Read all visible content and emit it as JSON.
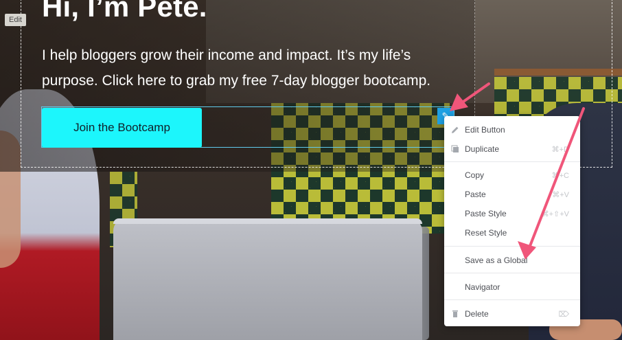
{
  "edit_tag": "Edit",
  "hero": {
    "title": "Hi, I’m Pete.",
    "text": "I help bloggers grow their income and impact. It’s my life’s purpose. Click here to grab my free 7-day blogger bootcamp.",
    "button_label": "Join the Bootcamp"
  },
  "colors": {
    "button": "#1cf6fc",
    "selection": "#61ccee",
    "handle": "#1ea0e3",
    "annotation_arrow": "#f0567a"
  },
  "context_menu": {
    "groups": [
      [
        {
          "label": "Edit Button",
          "icon": "pencil-icon",
          "shortcut": ""
        },
        {
          "label": "Duplicate",
          "icon": "copy-icon",
          "shortcut": "⌘+D"
        }
      ],
      [
        {
          "label": "Copy",
          "icon": "",
          "shortcut": "⌘+C"
        },
        {
          "label": "Paste",
          "icon": "",
          "shortcut": "⌘+V"
        },
        {
          "label": "Paste Style",
          "icon": "",
          "shortcut": "⌘+⇧+V"
        },
        {
          "label": "Reset Style",
          "icon": "",
          "shortcut": ""
        }
      ],
      [
        {
          "label": "Save as a Global",
          "icon": "",
          "shortcut": ""
        }
      ],
      [
        {
          "label": "Navigator",
          "icon": "",
          "shortcut": ""
        }
      ],
      [
        {
          "label": "Delete",
          "icon": "trash-icon",
          "shortcut": "⌦"
        }
      ]
    ]
  }
}
